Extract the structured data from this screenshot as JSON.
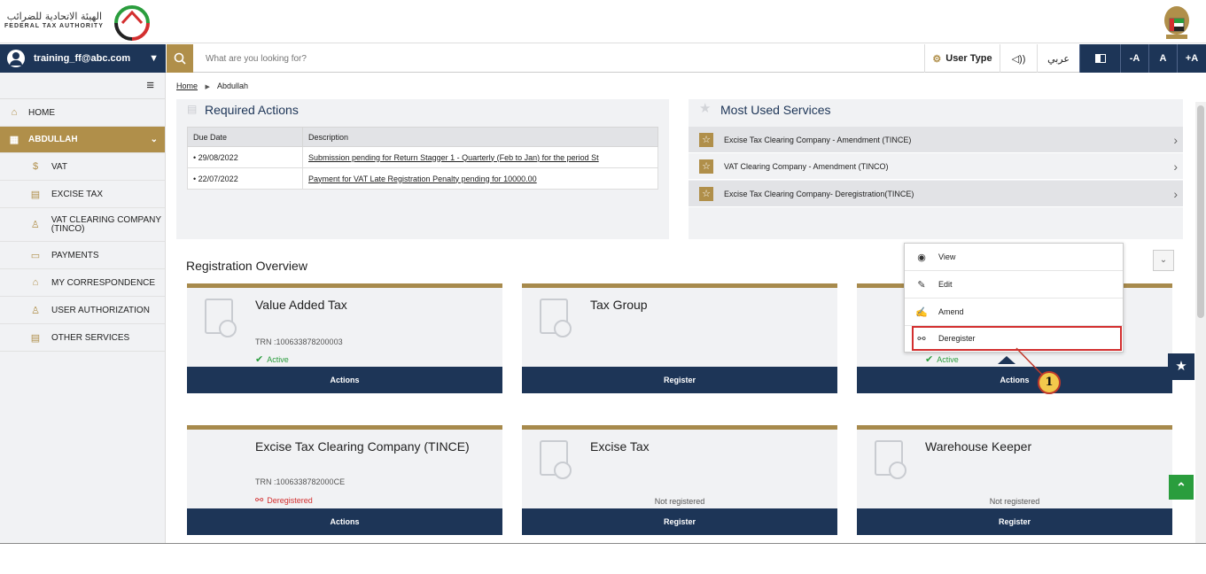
{
  "header": {
    "logo_ar": "الهيئة الاتحادية للضرائب",
    "logo_en": "FEDERAL TAX AUTHORITY"
  },
  "nav": {
    "user_email": "training_ff@abc.com",
    "search_placeholder": "What are you looking for?",
    "user_type": "User Type",
    "audio": "◁))",
    "arabic": "عربي",
    "font_minus": "-A",
    "font_normal": "A",
    "font_plus": "+A"
  },
  "sidebar": {
    "items": [
      {
        "label": "HOME",
        "icon": "home-icon",
        "glyph": "⌂"
      },
      {
        "label": "ABDULLAH",
        "icon": "grid-icon",
        "glyph": "▦"
      },
      {
        "label": "VAT",
        "icon": "vat-icon",
        "glyph": "$"
      },
      {
        "label": "EXCISE TAX",
        "icon": "excise-icon",
        "glyph": "▤"
      },
      {
        "label": "VAT CLEARING COMPANY (TINCO)",
        "icon": "person-icon",
        "glyph": "♙"
      },
      {
        "label": "PAYMENTS",
        "icon": "card-icon",
        "glyph": "▭"
      },
      {
        "label": "MY CORRESPONDENCE",
        "icon": "building-icon",
        "glyph": "⌂"
      },
      {
        "label": "USER AUTHORIZATION",
        "icon": "user-auth-icon",
        "glyph": "♙"
      },
      {
        "label": "OTHER SERVICES",
        "icon": "clipboard-icon",
        "glyph": "▤"
      }
    ]
  },
  "breadcrumb": {
    "home": "Home",
    "current": "Abdullah"
  },
  "required_actions": {
    "title": "Required Actions",
    "columns": [
      "Due Date",
      "Description"
    ],
    "rows": [
      {
        "date": "• 29/08/2022",
        "desc": "Submission pending for Return Stagger 1 - Quarterly (Feb to Jan) for the period St"
      },
      {
        "date": "• 22/07/2022",
        "desc": "Payment for VAT Late Registration Penalty pending for 10000.00"
      }
    ]
  },
  "most_used": {
    "title": "Most Used Services",
    "items": [
      "Excise Tax Clearing Company - Amendment (TINCE)",
      "VAT Clearing Company - Amendment (TINCO)",
      "Excise Tax Clearing Company- Deregistration(TINCE)"
    ]
  },
  "registration": {
    "title": "Registration Overview",
    "cards": [
      {
        "title": "Value Added Tax",
        "trn": "TRN :100633878200003",
        "status": "Active",
        "button": "Actions"
      },
      {
        "title": "Tax Group",
        "button": "Register"
      },
      {
        "status": "Active",
        "button": "Actions"
      },
      {
        "title": "Excise Tax Clearing Company (TINCE)",
        "trn": "TRN :1006338782000CE",
        "status": "Deregistered",
        "button": "Actions"
      },
      {
        "title": "Excise Tax",
        "not_registered": "Not registered",
        "button": "Register"
      },
      {
        "title": "Warehouse Keeper",
        "not_registered": "Not registered",
        "button": "Register"
      }
    ]
  },
  "dropdown": {
    "items": [
      "View",
      "Edit",
      "Amend",
      "Deregister"
    ]
  },
  "callout_number": "1",
  "colors": {
    "navy": "#1d3557",
    "gold": "#b08f4a",
    "green": "#2a9d3d",
    "red": "#d32f2f"
  }
}
